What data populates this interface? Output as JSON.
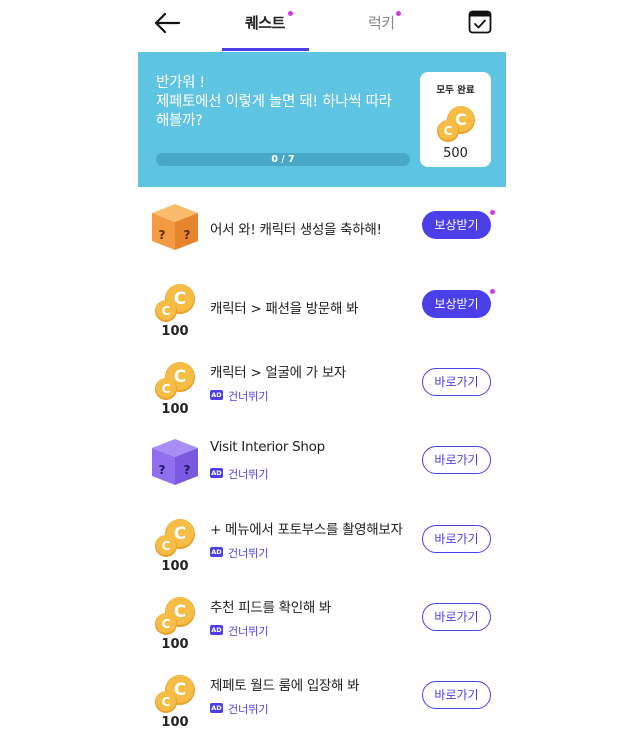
{
  "header": {
    "tabs": [
      {
        "label": "퀘스트",
        "active": true,
        "has_dot": true
      },
      {
        "label": "럭키",
        "active": false,
        "has_dot": true
      }
    ],
    "back_icon": "arrow-left-icon",
    "right_icon": "calendar-check-icon"
  },
  "banner": {
    "line1": "반가워 !",
    "line2": "제페토에선 이렇게 놀면 돼! 하나씩 따라",
    "line3": "해볼까?",
    "progress_label": "0 / 7",
    "progress_fraction": 0,
    "reward_title": "모두 완료",
    "reward_amount": "500"
  },
  "quests": [
    {
      "title": "어서 와! 캐릭터 생성을 축하해!",
      "icon": "orange-mystery-box-icon",
      "button": "보상받기",
      "button_style": "filled",
      "has_dot": true
    },
    {
      "title": "캐릭터 > 패션을 방문해 봐",
      "icon": "coin-icon",
      "amount": "100",
      "button": "보상받기",
      "button_style": "filled",
      "has_dot": true
    },
    {
      "title": "캐릭터 > 얼굴에 가 보자",
      "icon": "coin-icon",
      "amount": "100",
      "ad": "AD",
      "skip": "건너뛰기",
      "button": "바로가기",
      "button_style": "outline"
    },
    {
      "title": "Visit Interior Shop",
      "icon": "purple-mystery-box-icon",
      "ad": "AD",
      "skip": "건너뛰기",
      "button": "바로가기",
      "button_style": "outline"
    },
    {
      "title": "+ 메뉴에서 포토부스를 촬영해보자",
      "icon": "coin-icon",
      "amount": "100",
      "ad": "AD",
      "skip": "건너뛰기",
      "button": "바로가기",
      "button_style": "outline"
    },
    {
      "title": "추천 피드를 확인해 봐",
      "icon": "coin-icon",
      "amount": "100",
      "ad": "AD",
      "skip": "건너뛰기",
      "button": "바로가기",
      "button_style": "outline"
    },
    {
      "title": "제페토 월드 룸에 입장해 봐",
      "icon": "coin-icon",
      "amount": "100",
      "ad": "AD",
      "skip": "건너뛰기",
      "button": "바로가기",
      "button_style": "outline"
    }
  ],
  "colors": {
    "accent": "#4b3fe8",
    "banner": "#5fc3e2",
    "coin": "#f2b53a",
    "dot": "#d23be0"
  }
}
